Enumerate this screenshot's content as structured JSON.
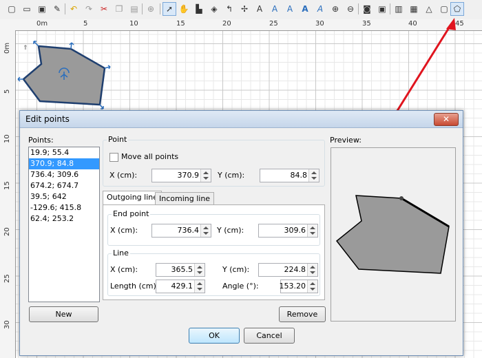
{
  "toolbar": {
    "icons": [
      "new-icon",
      "open-icon",
      "save-icon",
      "preferences-icon",
      "undo-icon",
      "redo-icon",
      "cut-icon",
      "copy-icon",
      "paste-icon",
      "add-furniture-icon",
      "select-icon",
      "pan-icon",
      "create-walls-icon",
      "create-rooms-icon",
      "create-polylines-icon",
      "create-dimensions-icon",
      "add-text-icon",
      "text-style-icon",
      "bold-icon",
      "italic-icon",
      "zoom-in-icon",
      "zoom-out-icon",
      "create-photo-icon",
      "create-video-icon",
      "import-furniture-icon",
      "export-icon",
      "3d-view-icon",
      "edit-points-icon"
    ]
  },
  "ruler": {
    "h_labels": [
      "0m",
      "5",
      "10",
      "15",
      "20",
      "25",
      "30",
      "35",
      "40",
      "45"
    ],
    "v_labels": [
      "0m",
      "5",
      "10",
      "15",
      "20",
      "25",
      "30"
    ]
  },
  "dialog": {
    "title": "Edit points",
    "close_label": "✕",
    "points_label": "Points:",
    "points": [
      "19.9; 55.4",
      "370.9; 84.8",
      "736.4; 309.6",
      "674.2; 674.7",
      "39.5; 642",
      "-129.6; 415.8",
      "62.4; 253.2"
    ],
    "selected_index": 1,
    "new_label": "New",
    "remove_label": "Remove",
    "ok_label": "OK",
    "cancel_label": "Cancel",
    "point_group": "Point",
    "move_all_label": "Move all points",
    "x_label": "X (cm):",
    "y_label": "Y (cm):",
    "point_x": "370.9",
    "point_y": "84.8",
    "tab_outgoing": "Outgoing line",
    "tab_incoming": "Incoming line",
    "end_point_group": "End point",
    "end_x": "736.4",
    "end_y": "309.6",
    "line_group": "Line",
    "line_x": "365.5",
    "line_y": "224.8",
    "length_label": "Length (cm):",
    "length": "429.1",
    "angle_label": "Angle (°):",
    "angle": "153.20",
    "preview_label": "Preview:"
  },
  "colors": {
    "accent": "#3399ff",
    "arrow": "#e0141e",
    "polygon_fill": "#9a9a9a",
    "handle": "#2a6ebd"
  }
}
